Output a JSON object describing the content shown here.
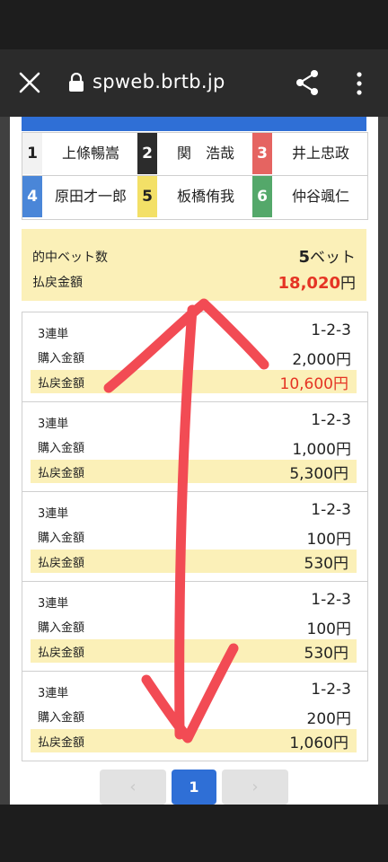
{
  "browser": {
    "url": "spweb.brtb.jp"
  },
  "racers": [
    {
      "num": "1",
      "name": "上條暢嵩",
      "bg": "#f2f2f2",
      "fg": "#222222"
    },
    {
      "num": "2",
      "name": "関　浩哉",
      "bg": "#2c2c2c",
      "fg": "#ffffff"
    },
    {
      "num": "3",
      "name": "井上忠政",
      "bg": "#e56461",
      "fg": "#ffffff"
    },
    {
      "num": "4",
      "name": "原田才一郎",
      "bg": "#4a86d8",
      "fg": "#ffffff"
    },
    {
      "num": "5",
      "name": "板橋侑我",
      "bg": "#f3e067",
      "fg": "#222222"
    },
    {
      "num": "6",
      "name": "仲谷颯仁",
      "bg": "#54a86a",
      "fg": "#ffffff"
    }
  ],
  "summary": {
    "hit_label": "的中ベット数",
    "hit_count": "5",
    "hit_unit": "ベット",
    "payout_label": "払戻金額",
    "payout_amount": "18,020",
    "payout_unit": "円"
  },
  "bets": [
    {
      "type": "3連単",
      "combo": "1-2-3",
      "purchase_label": "購入金額",
      "purchase": "2,000円",
      "payout_label": "払戻金額",
      "payout": "10,600円",
      "highlight": true
    },
    {
      "type": "3連単",
      "combo": "1-2-3",
      "purchase_label": "購入金額",
      "purchase": "1,000円",
      "payout_label": "払戻金額",
      "payout": "5,300円",
      "highlight": false
    },
    {
      "type": "3連単",
      "combo": "1-2-3",
      "purchase_label": "購入金額",
      "purchase": "100円",
      "payout_label": "払戻金額",
      "payout": "530円",
      "highlight": false
    },
    {
      "type": "3連単",
      "combo": "1-2-3",
      "purchase_label": "購入金額",
      "purchase": "100円",
      "payout_label": "払戻金額",
      "payout": "530円",
      "highlight": false
    },
    {
      "type": "3連単",
      "combo": "1-2-3",
      "purchase_label": "購入金額",
      "purchase": "200円",
      "payout_label": "払戻金額",
      "payout": "1,060円",
      "highlight": false
    }
  ],
  "pager": {
    "prev": "‹",
    "current": "1",
    "next": "›"
  },
  "colors": {
    "accent_blue": "#2f6fd6",
    "highlight_yellow": "#fbf0b8",
    "payout_red": "#e53424",
    "annotation_red": "#f24b54"
  },
  "icons": [
    "close-icon",
    "lock-icon",
    "share-icon",
    "more-vert-icon"
  ]
}
